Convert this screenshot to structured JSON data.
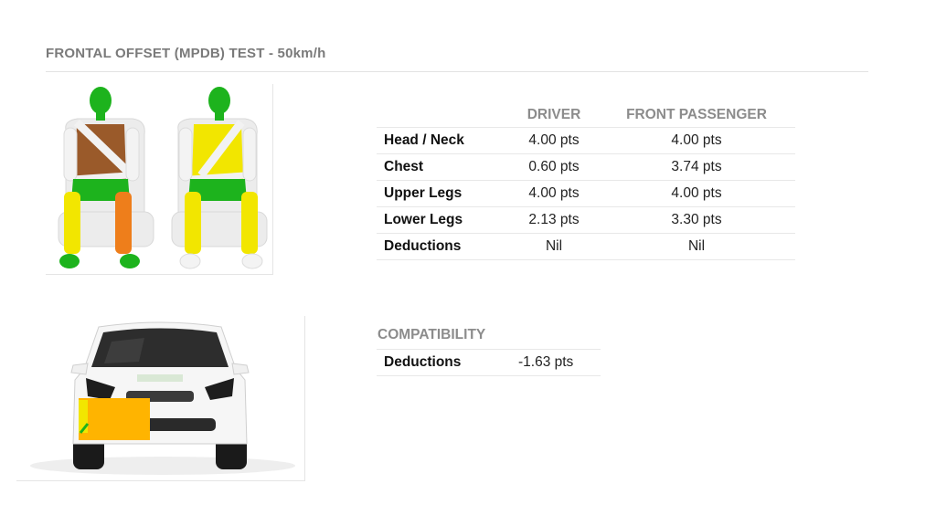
{
  "section": {
    "title": "FRONTAL OFFSET (MPDB) TEST - 50km/h"
  },
  "results": {
    "columns": [
      "",
      "DRIVER",
      "FRONT PASSENGER"
    ],
    "rows": [
      {
        "label": "Head / Neck",
        "driver": "4.00 pts",
        "passenger": "4.00 pts"
      },
      {
        "label": "Chest",
        "driver": "0.60 pts",
        "passenger": "3.74 pts"
      },
      {
        "label": "Upper Legs",
        "driver": "4.00 pts",
        "passenger": "4.00 pts"
      },
      {
        "label": "Lower Legs",
        "driver": "2.13 pts",
        "passenger": "3.30 pts"
      },
      {
        "label": "Deductions",
        "driver": "Nil",
        "passenger": "Nil"
      }
    ]
  },
  "compatibility": {
    "title": "COMPATIBILITY",
    "label": "Deductions",
    "value": "-1.63 pts"
  },
  "colors": {
    "good": "#1db31d",
    "adequate": "#f2e600",
    "marginal": "#ee7e1b",
    "weak": "#9a5a2a",
    "barrier": "#ffb400"
  },
  "dummies": {
    "driver": {
      "head": "good",
      "chest": "weak",
      "upper_legs": "good",
      "lower_leg_left": "adequate",
      "lower_leg_right": "marginal",
      "feet": "good"
    },
    "passenger": {
      "head": "good",
      "chest": "adequate",
      "upper_legs": "good",
      "lower_leg_left": "adequate",
      "lower_leg_right": "adequate",
      "feet": "white"
    }
  }
}
